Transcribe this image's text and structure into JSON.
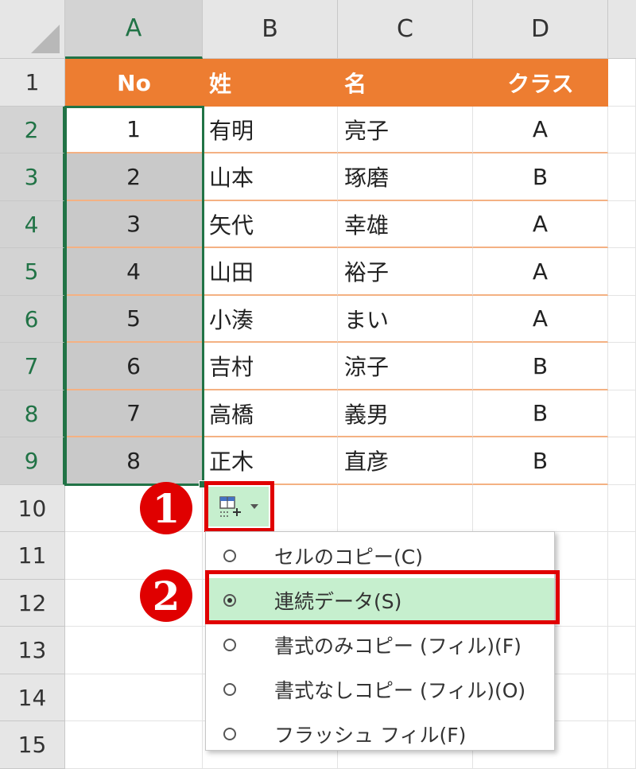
{
  "columns": [
    "A",
    "B",
    "C",
    "D"
  ],
  "rows": [
    "1",
    "2",
    "3",
    "4",
    "5",
    "6",
    "7",
    "8",
    "9",
    "10",
    "11",
    "12",
    "13",
    "14",
    "15"
  ],
  "table": {
    "headers": [
      "No",
      "姓",
      "名",
      "クラス"
    ],
    "records": [
      {
        "no": "1",
        "sei": "有明",
        "mei": "亮子",
        "class": "A"
      },
      {
        "no": "2",
        "sei": "山本",
        "mei": "琢磨",
        "class": "B"
      },
      {
        "no": "3",
        "sei": "矢代",
        "mei": "幸雄",
        "class": "A"
      },
      {
        "no": "4",
        "sei": "山田",
        "mei": "裕子",
        "class": "A"
      },
      {
        "no": "5",
        "sei": "小湊",
        "mei": "まい",
        "class": "A"
      },
      {
        "no": "6",
        "sei": "吉村",
        "mei": "涼子",
        "class": "B"
      },
      {
        "no": "7",
        "sei": "高橋",
        "mei": "義男",
        "class": "B"
      },
      {
        "no": "8",
        "sei": "正木",
        "mei": "直彦",
        "class": "B"
      }
    ]
  },
  "autofill": {
    "icon": "autofill-options-icon",
    "menu": [
      {
        "label": "セルのコピー(C)",
        "selected": false
      },
      {
        "label": "連続データ(S)",
        "selected": true
      },
      {
        "label": "書式のみコピー (フィル)(F)",
        "selected": false
      },
      {
        "label": "書式なしコピー (フィル)(O)",
        "selected": false
      },
      {
        "label": "フラッシュ フィル(F)",
        "selected": false
      }
    ]
  },
  "annotations": {
    "step1": "1",
    "step2": "2"
  },
  "colors": {
    "header_fill": "#ed7d31",
    "row_border": "#f4b183",
    "selection": "#217346",
    "highlight": "#c6efce",
    "callout": "#e00000"
  }
}
